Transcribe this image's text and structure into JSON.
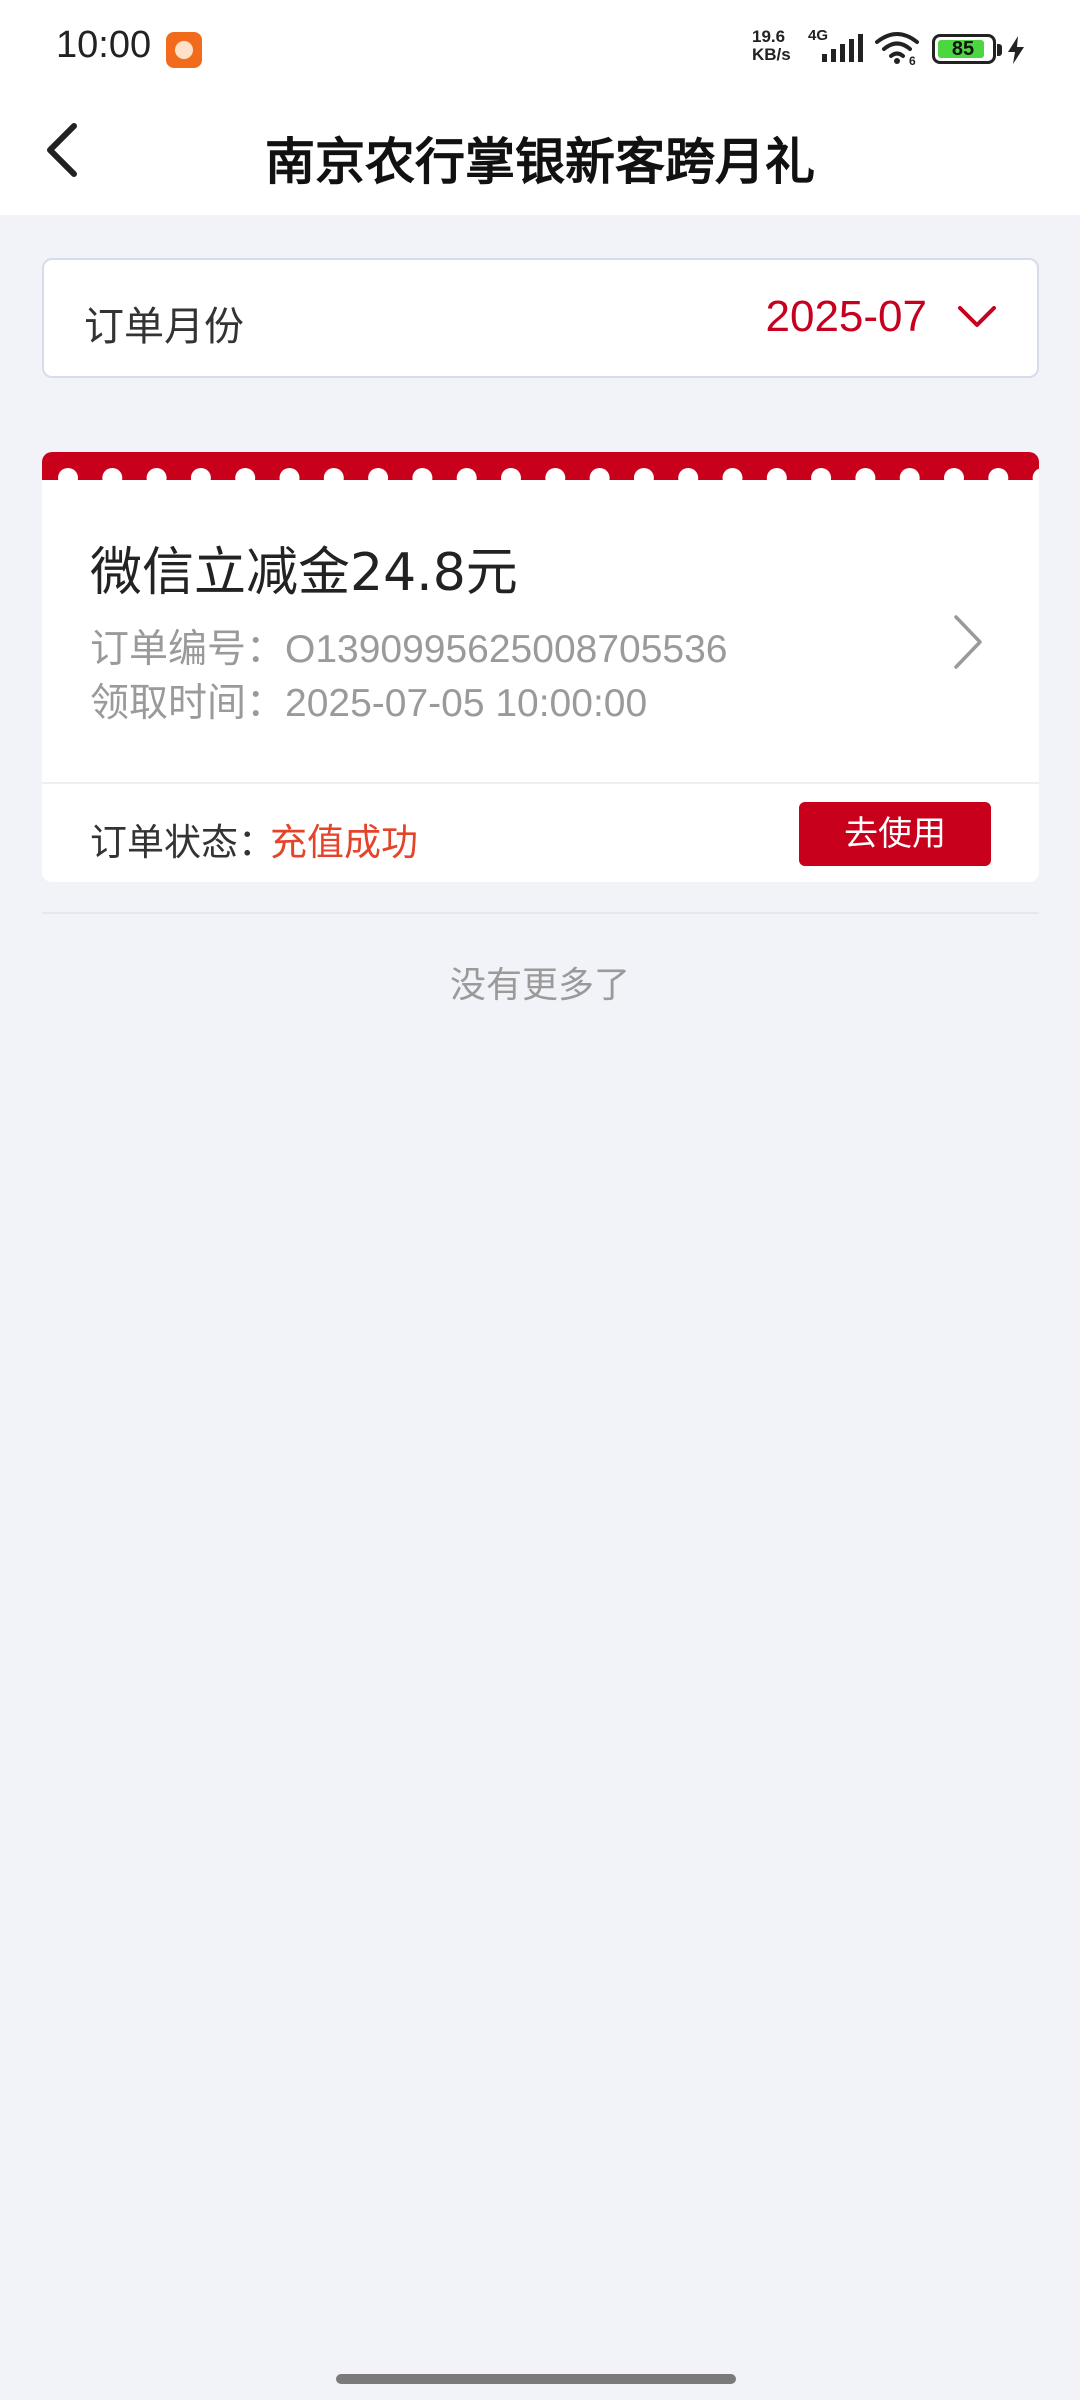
{
  "status_bar": {
    "time": "10:00",
    "net_speed_value": "19.6",
    "net_speed_unit": "KB/s",
    "network_type": "4G",
    "wifi_badge": "6",
    "battery": "85"
  },
  "header": {
    "title": "南京农行掌银新客跨月礼",
    "back_icon": "chevron-left-icon"
  },
  "month_filter": {
    "label": "订单月份",
    "value": "2025-07",
    "icon": "chevron-down-icon"
  },
  "order": {
    "title": "微信立减金24.8元",
    "number_label": "订单编号：",
    "number_value": "O1390995625008705536",
    "time_label": "领取时间：",
    "time_value": "2025-07-05 10:00:00",
    "status_label": "订单状态：",
    "status_value": "充值成功",
    "action_label": "去使用",
    "icon": "chevron-right-icon"
  },
  "list_end_text": "没有更多了",
  "colors": {
    "brand_red": "#c8001c",
    "status_orange": "#e4442a",
    "background": "#f2f3f9"
  }
}
